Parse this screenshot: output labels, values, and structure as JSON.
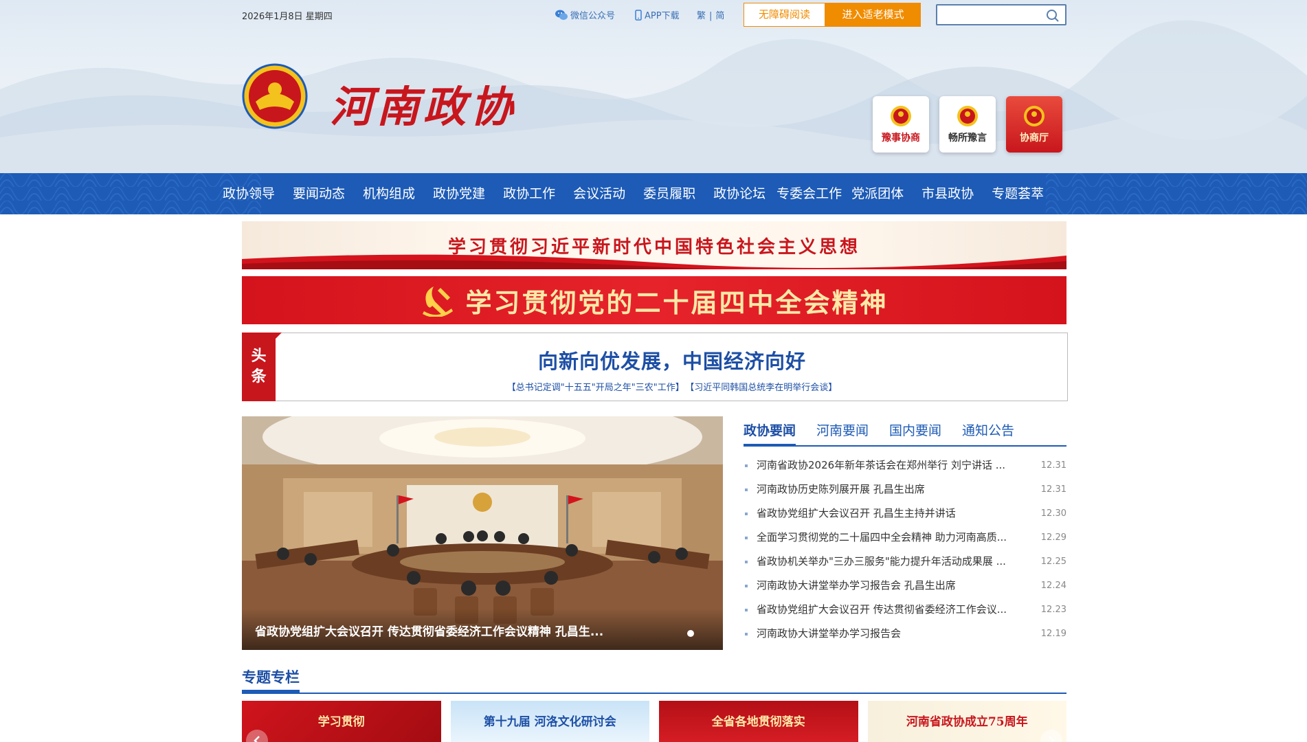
{
  "topbar": {
    "date": "2026年1月8日 星期四",
    "wechat_label": "微信公众号",
    "app_label": "APP下载",
    "lang_traditional": "繁",
    "lang_separator": "|",
    "lang_simplified": "简",
    "accessible_reading": "无障碍阅读",
    "elder_mode": "进入适老模式",
    "search_placeholder": "",
    "icons": {
      "wechat": "wechat-icon",
      "phone": "phone-icon",
      "search": "search-icon"
    }
  },
  "brand": {
    "title": "河南政协"
  },
  "side_apps": [
    {
      "label": "豫事协商",
      "icon": "cppcc-emblem-icon"
    },
    {
      "label": "畅所豫言",
      "icon": "cppcc-emblem-icon"
    },
    {
      "label": "协商厅",
      "icon": "cppcc-emblem-icon"
    }
  ],
  "nav": {
    "items": [
      "政协领导",
      "要闻动态",
      "机构组成",
      "政协党建",
      "政协工作",
      "会议活动",
      "委员履职",
      "政协论坛",
      "专委会工作",
      "党派团体",
      "市县政协",
      "专题荟萃"
    ]
  },
  "banners": {
    "banner1": "学习贯彻习近平新时代中国特色社会主义思想",
    "banner2": "学习贯彻党的二十届四中全会精神"
  },
  "headline": {
    "tag_line1": "头",
    "tag_line2": "条",
    "title": "向新向优发展，中国经济向好",
    "link1": "【总书记定调\"十五五\"开局之年\"三农\"工作】",
    "link2": "【习近平同韩国总统李在明举行会谈】"
  },
  "carousel": {
    "caption": "省政协党组扩大会议召开 传达贯彻省委经济工作会议精神 孔昌生..."
  },
  "news": {
    "tabs": [
      "政协要闻",
      "河南要闻",
      "国内要闻",
      "通知公告"
    ],
    "active_tab": 0,
    "items": [
      {
        "title": "河南省政协2026年新年茶话会在郑州举行 刘宁讲话 ...",
        "date": "12.31"
      },
      {
        "title": "河南政协历史陈列展开展 孔昌生出席",
        "date": "12.31"
      },
      {
        "title": "省政协党组扩大会议召开 孔昌生主持并讲话",
        "date": "12.30"
      },
      {
        "title": "全面学习贯彻党的二十届四中全会精神 助力河南高质...",
        "date": "12.29"
      },
      {
        "title": "省政协机关举办\"三办三服务\"能力提升年活动成果展 ...",
        "date": "12.25"
      },
      {
        "title": "河南政协大讲堂举办学习报告会 孔昌生出席",
        "date": "12.24"
      },
      {
        "title": "省政协党组扩大会议召开 传达贯彻省委经济工作会议...",
        "date": "12.23"
      },
      {
        "title": "河南政协大讲堂举办学习报告会",
        "date": "12.19"
      }
    ]
  },
  "special": {
    "title": "专题专栏",
    "cards": [
      "学习贯彻",
      "第十九届 河洛文化研讨会",
      "全省各地贯彻落实",
      "河南省政协成立75周年"
    ]
  },
  "colors": {
    "nav_blue": "#1d5bb6",
    "brand_red": "#c8161d",
    "accent_orange": "#f08c00",
    "link_blue": "#1d4fa5"
  }
}
